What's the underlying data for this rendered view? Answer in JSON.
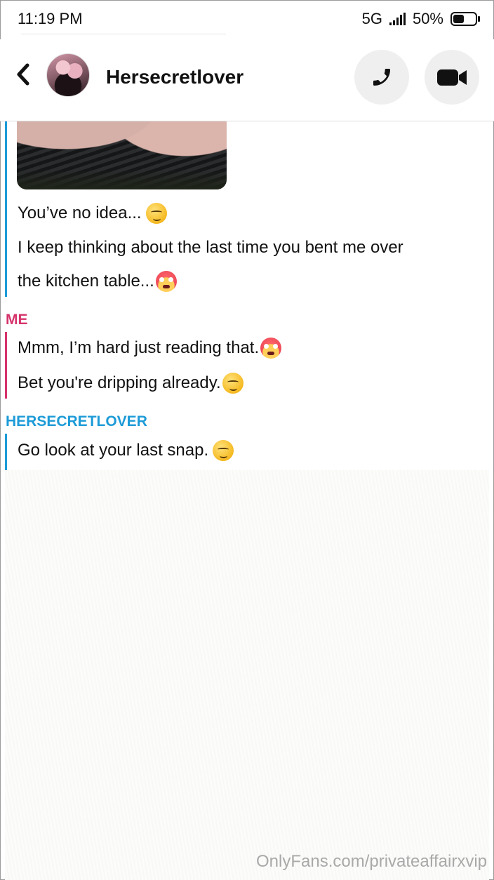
{
  "status_bar": {
    "time": "11:19 PM",
    "network": "5G",
    "battery": "50%",
    "battery_level": 0.5
  },
  "header": {
    "contact_name": "Hersecretlover",
    "back_icon": "chevron-left-icon",
    "phone_icon": "phone-icon",
    "video_icon": "video-camera-icon"
  },
  "chat": {
    "her_messages_1": [
      {
        "text": "You’ve no idea...",
        "emoji": "smirk"
      },
      {
        "text": "I keep thinking about the last time you bent me over",
        "emoji": ""
      },
      {
        "text": "the kitchen table...",
        "emoji": "flushed"
      }
    ],
    "me_sender": "ME",
    "me_messages": [
      {
        "text": "Mmm, I’m hard just reading that.",
        "emoji": "flushed"
      },
      {
        "text": "Bet you're dripping already.",
        "emoji": "smirk"
      }
    ],
    "her_sender": "HERSECRETLOVER",
    "her_messages_2": [
      {
        "text": "Go look at your last snap.",
        "emoji": "smirk"
      }
    ]
  },
  "watermark": "OnlyFans.com/privateaffairxvip",
  "colors": {
    "her_accent": "#1d9bd7",
    "me_accent": "#d6336c"
  }
}
